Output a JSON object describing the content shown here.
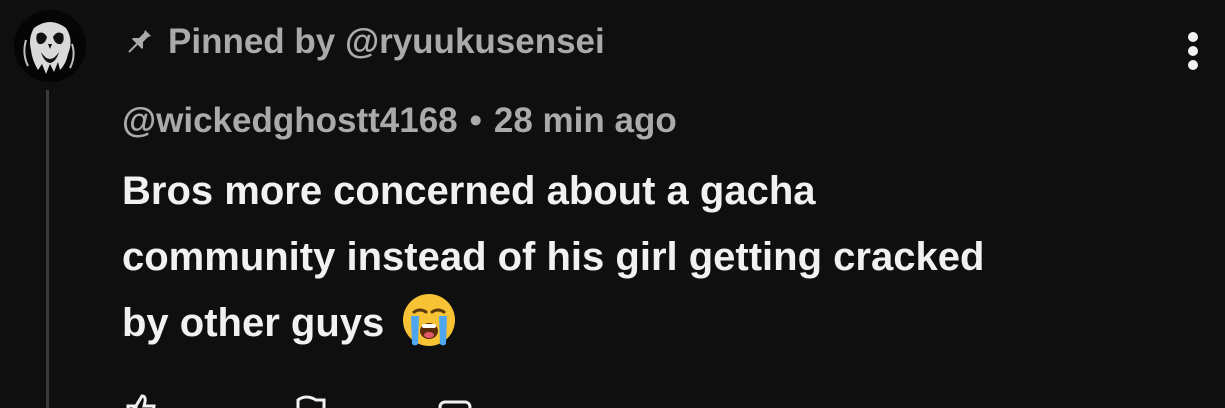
{
  "pinned": {
    "icon": "pin-icon",
    "text": "Pinned by @ryuukusensei"
  },
  "comment": {
    "author": "@wickedghostt4168",
    "separator": "•",
    "time": "28 min ago",
    "body_lines": [
      "Bros more concerned about a gacha",
      "community instead of his girl getting cracked",
      "by other guys"
    ],
    "emoji": "loudly-crying-face"
  },
  "menu": {
    "icon": "more-vertical-icon"
  },
  "actions": {
    "icons": [
      "like-icon",
      "dislike-icon",
      "reply-icon"
    ]
  },
  "colors": {
    "background": "#0f0f0f",
    "secondary_text": "#aaaaaa",
    "primary_text": "#f1f1f1"
  }
}
